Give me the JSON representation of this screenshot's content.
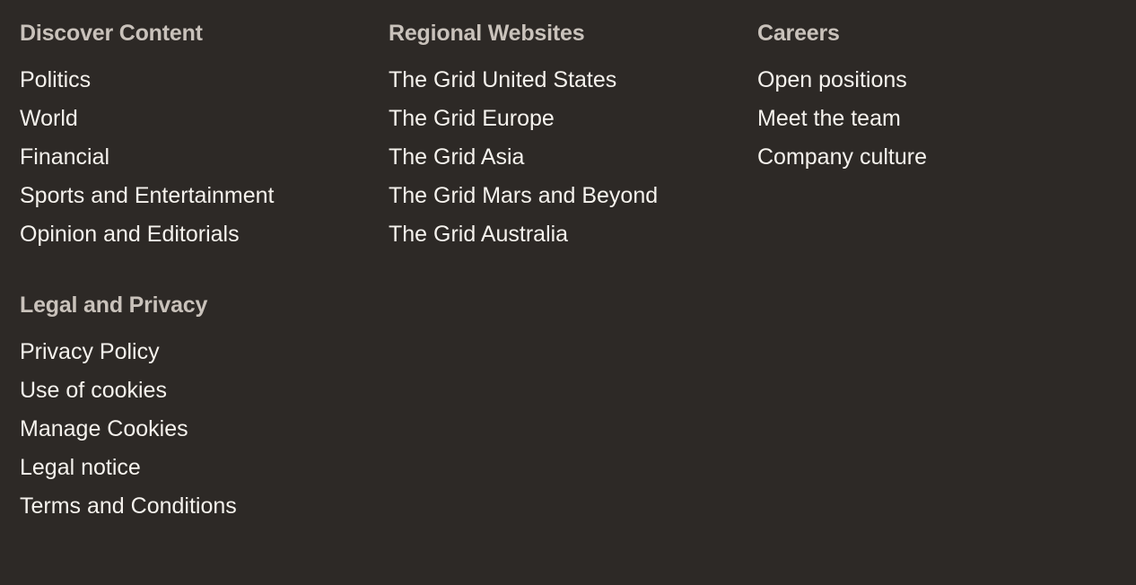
{
  "footer": {
    "background_color": "#2d2926",
    "heading_color": "#c9c2bb",
    "link_color": "#f5f2ed",
    "sections": [
      {
        "id": "discover-content",
        "heading": "Discover Content",
        "links": [
          "Politics",
          "World",
          "Financial",
          "Sports and Entertainment",
          "Opinion and Editorials"
        ]
      },
      {
        "id": "regional-websites",
        "heading": "Regional Websites",
        "links": [
          "The Grid United States",
          "The Grid Europe",
          "The Grid Asia",
          "The Grid Mars and Beyond",
          "The Grid Australia"
        ]
      },
      {
        "id": "careers",
        "heading": "Careers",
        "links": [
          "Open positions",
          "Meet the team",
          "Company culture"
        ]
      },
      {
        "id": "legal-and-privacy",
        "heading": "Legal and Privacy",
        "links": [
          "Privacy Policy",
          "Use of cookies",
          "Manage Cookies",
          "Legal notice",
          "Terms and Conditions"
        ]
      }
    ]
  }
}
